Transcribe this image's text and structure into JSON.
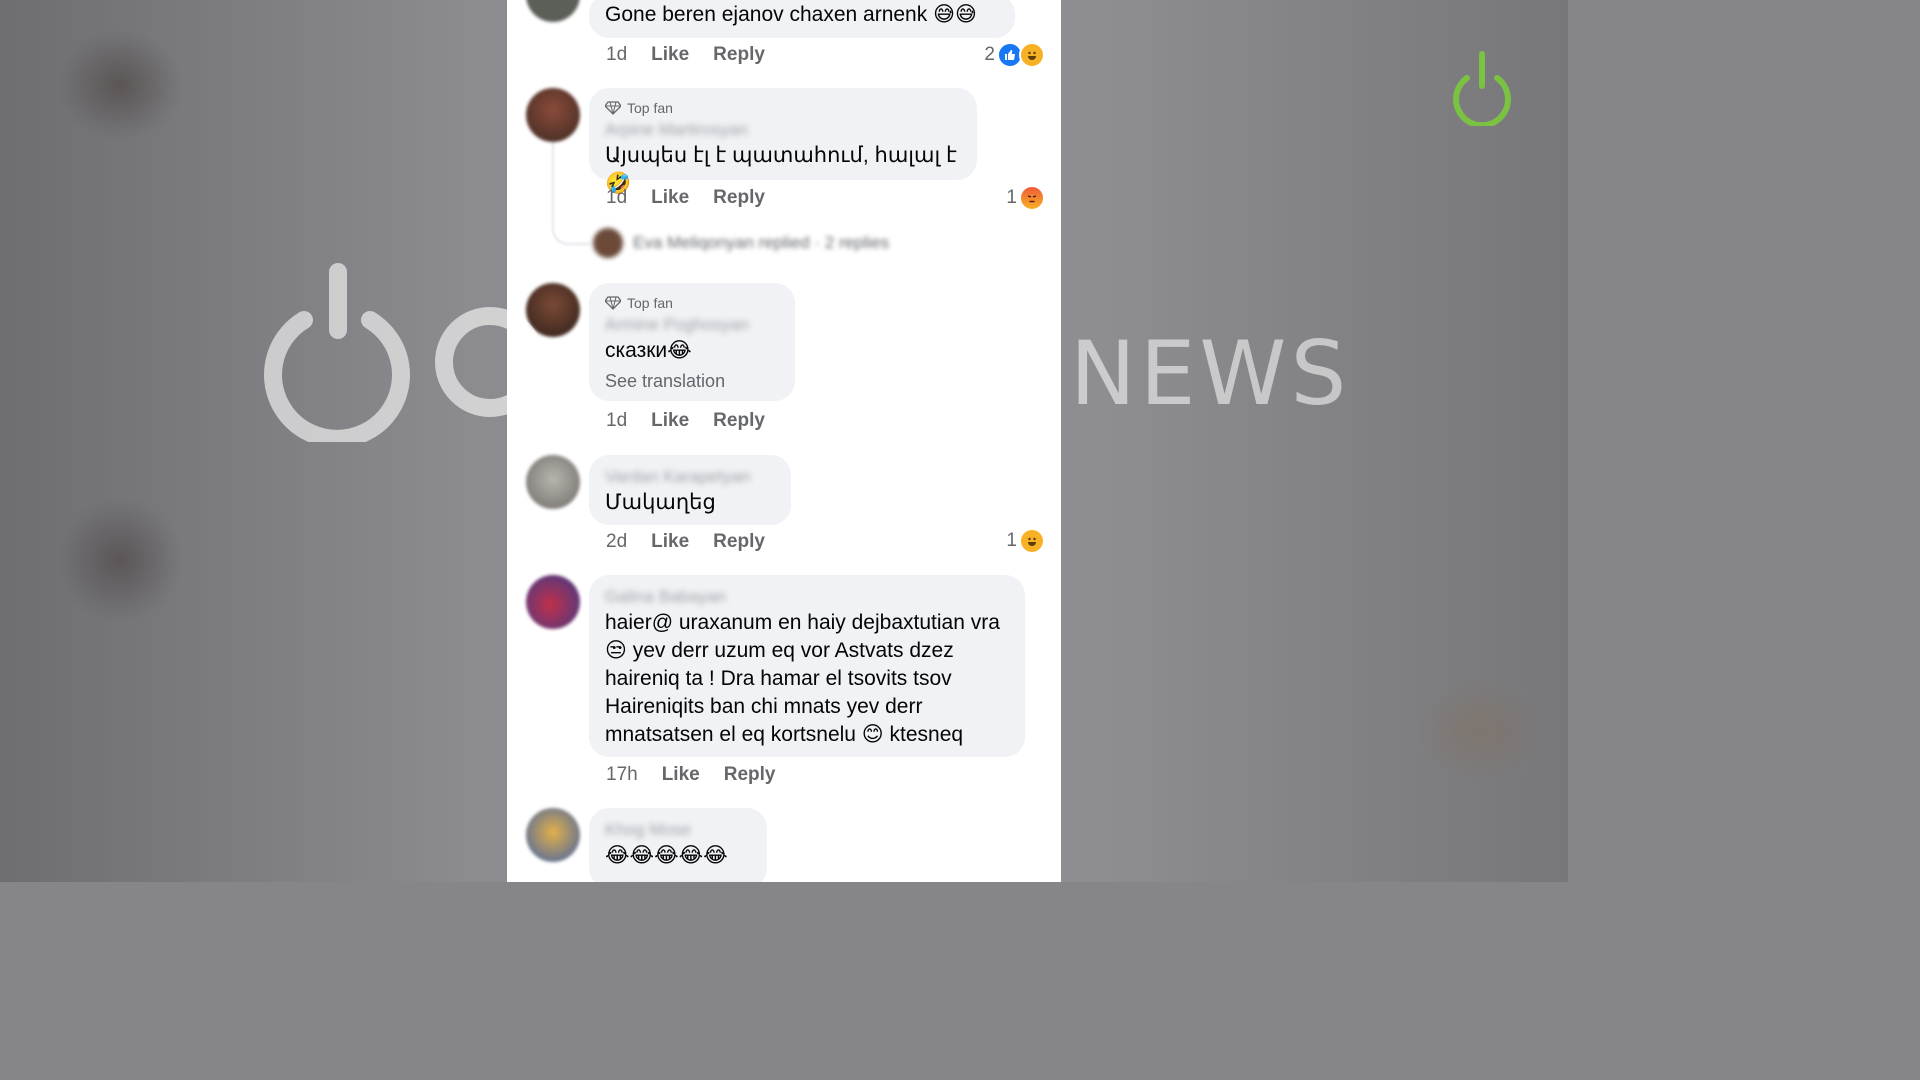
{
  "comments": [
    {
      "text": "Gone beren ejanov chaxen arnenk 😅😅",
      "time": "1d",
      "like": "Like",
      "reply": "Reply",
      "reaction_count": "2",
      "reactions": [
        "like",
        "haha"
      ]
    },
    {
      "badge": "Top fan",
      "author": "Arpine Martirosyan",
      "text": "Այսպես էլ է պատահում, հալալ է 🤣",
      "time": "1d",
      "like": "Like",
      "reply": "Reply",
      "reaction_count": "1",
      "reactions": [
        "angry"
      ],
      "replied_summary": "Eva Meliqonyan replied · 2 replies"
    },
    {
      "badge": "Top fan",
      "author": "Armine Poghosyan",
      "text": "сказки😂",
      "see_translation": "See translation",
      "time": "1d",
      "like": "Like",
      "reply": "Reply"
    },
    {
      "author": "Vardan Karapetyan",
      "text": "Մակաղեց",
      "time": "2d",
      "like": "Like",
      "reply": "Reply",
      "reaction_count": "1",
      "reactions": [
        "haha"
      ]
    },
    {
      "author": "Galina Babayan",
      "text": "haier@ uraxanum en haiy dejbaxtutian vra\n😒 yev derr uzum eq vor Astvats dzez\nhaireniq ta ! Dra hamar el tsovits tsov\nHaireniqits ban chi mnats yev derr\nmnatsatsen el eq kortsnelu 😊 ktesneq",
      "time": "17h",
      "like": "Like",
      "reply": "Reply"
    },
    {
      "author": "Khog Mose",
      "text": "😂😂😂😂😂"
    }
  ],
  "watermark": {
    "text": "NEWS"
  },
  "colors": {
    "bubble": "#f0f2f5",
    "like": "#1877f2",
    "haha": "#f7b125",
    "angry": "#e9710f",
    "logo_green": "#7cc242"
  }
}
